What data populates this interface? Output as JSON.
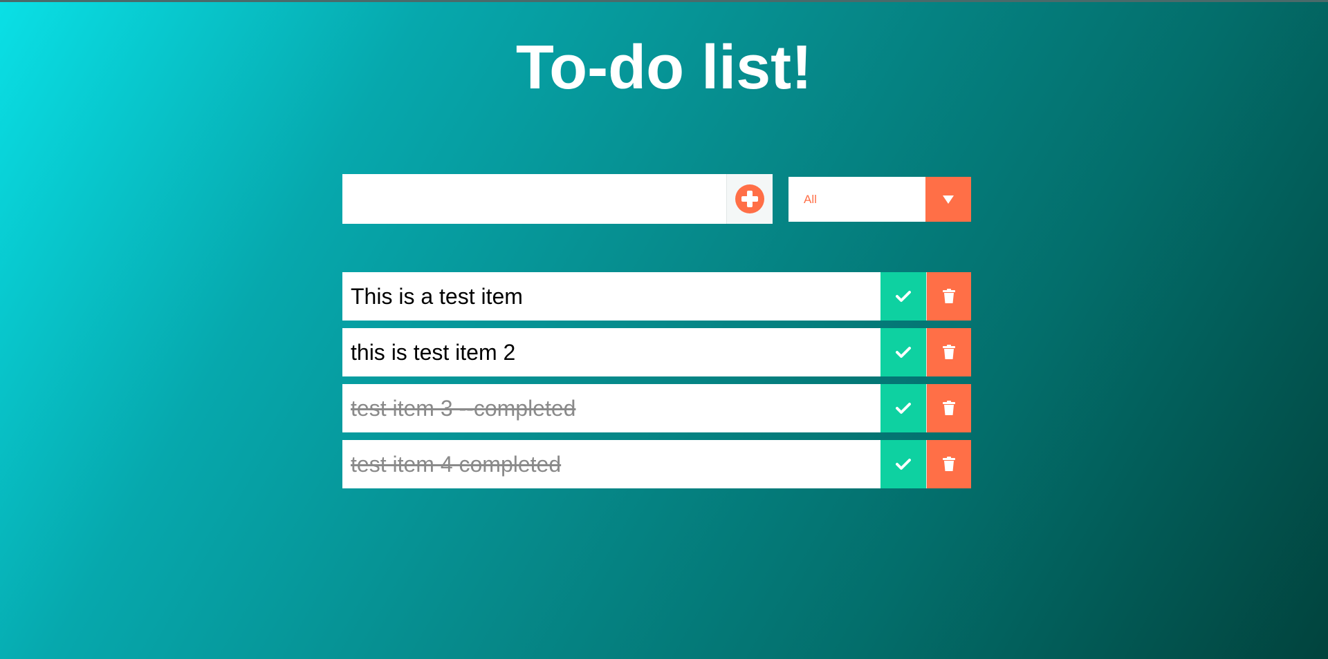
{
  "header": {
    "title": "To-do list!"
  },
  "add_form": {
    "input_value": "",
    "input_placeholder": "",
    "add_icon": "plus-circle-icon"
  },
  "filter": {
    "selected": "All",
    "arrow_icon": "caret-down-icon"
  },
  "todos": [
    {
      "text": "This is a test item",
      "completed": false
    },
    {
      "text": "this is test item 2",
      "completed": false
    },
    {
      "text": "test item 3 --completed",
      "completed": true
    },
    {
      "text": "test item 4 completed",
      "completed": true
    }
  ],
  "item_icons": {
    "complete": "check-icon",
    "delete": "trash-icon"
  },
  "colors": {
    "accent_orange": "#ff6f47",
    "check_green": "#0ed1a1",
    "gradient_start": "#0ae0e6",
    "gradient_end": "#01433d",
    "title_text": "#ffffff",
    "completed_text": "#8a8a8a"
  }
}
